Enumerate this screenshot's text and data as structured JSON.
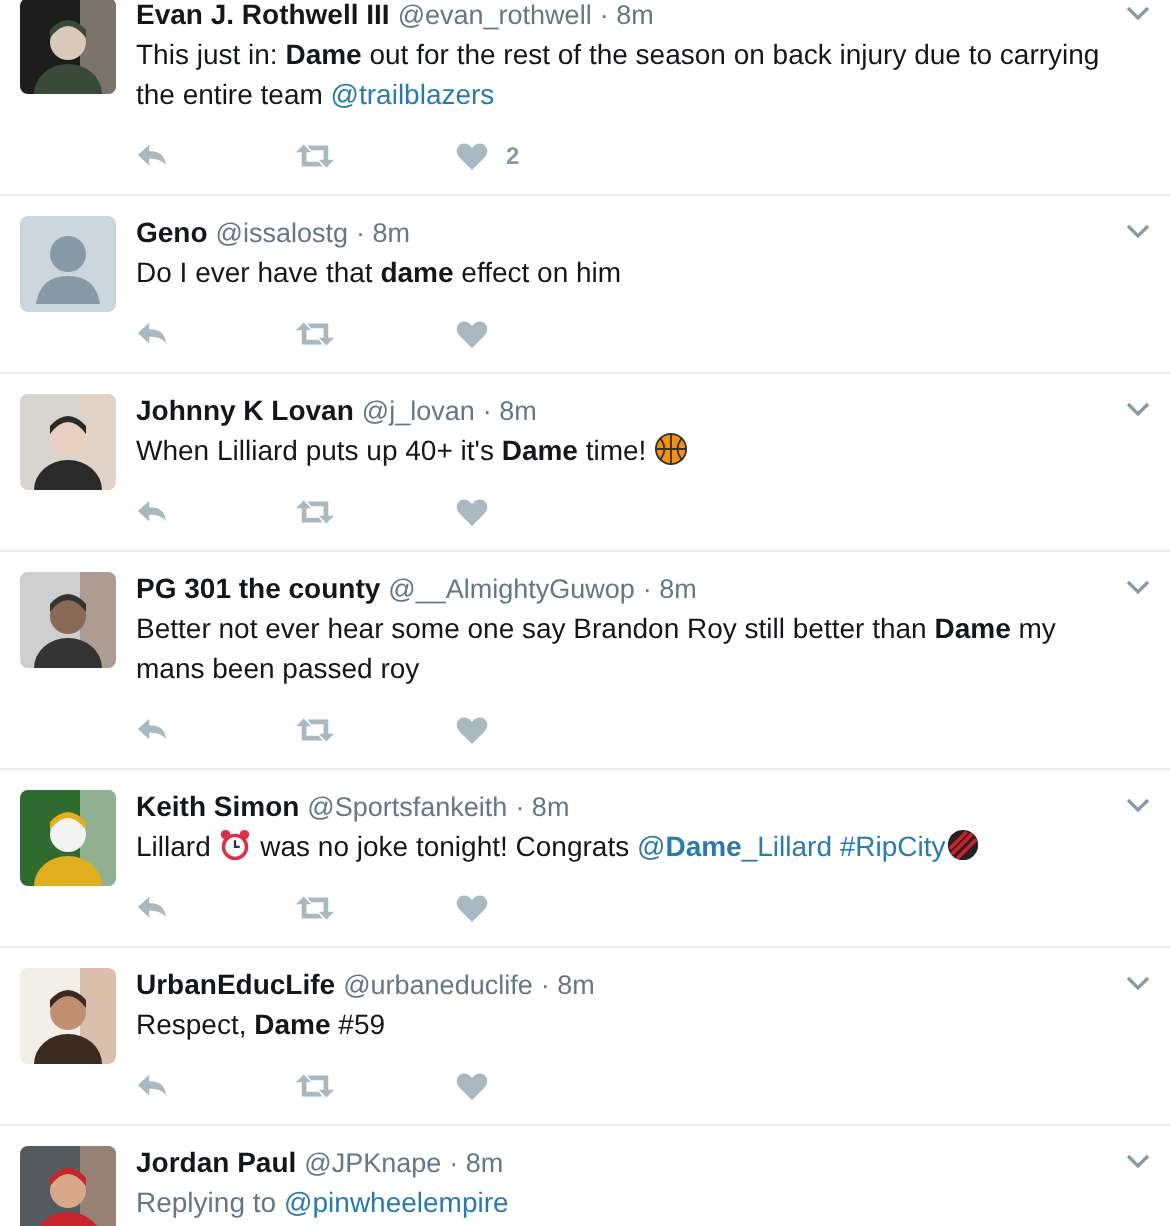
{
  "tweets": [
    {
      "avatar": {
        "kind": "picture"
      },
      "name": "Evan J. Rothwell III",
      "handle": "@evan_rothwell",
      "time": "· 8m",
      "parts": [
        {
          "kind": "text",
          "text": "This just in: **Dame** out for the rest of the season on back injury due to carrying the entire team "
        },
        {
          "kind": "link",
          "text": "@trailblazers"
        }
      ],
      "likes": "2"
    },
    {
      "avatar": {
        "kind": "default"
      },
      "name": "Geno",
      "handle": "@issalostg",
      "time": "· 8m",
      "parts": [
        {
          "kind": "text",
          "text": "Do I ever have that **dame** effect on him"
        }
      ]
    },
    {
      "avatar": {
        "kind": "picture"
      },
      "name": "Johnny K Lovan",
      "handle": "@j_lovan",
      "time": "· 8m",
      "parts": [
        {
          "kind": "text",
          "text": "When Lilliard puts up 40+ it's **Dame** time! "
        },
        {
          "kind": "basketball"
        }
      ]
    },
    {
      "avatar": {
        "kind": "picture"
      },
      "name": "PG 301 the county",
      "handle": "@__AlmightyGuwop",
      "time": "· 8m",
      "parts": [
        {
          "kind": "text",
          "text": "Better not ever hear some one say Brandon Roy still better than **Dame** my mans been passed roy"
        }
      ]
    },
    {
      "avatar": {
        "kind": "picture"
      },
      "name": "Keith Simon",
      "handle": "@Sportsfankeith",
      "time": "· 8m",
      "parts": [
        {
          "kind": "text",
          "text": "Lillard "
        },
        {
          "kind": "alarm"
        },
        {
          "kind": "text",
          "text": " was no joke tonight! Congrats "
        },
        {
          "kind": "link",
          "text": "@**Dame**_Lillard"
        },
        {
          "kind": "link",
          "text": "#RipCity"
        },
        {
          "kind": "pinwheel"
        }
      ]
    },
    {
      "avatar": {
        "kind": "picture"
      },
      "name": "UrbanEducLife",
      "handle": "@urbaneduclife",
      "time": "· 8m",
      "parts": [
        {
          "kind": "text",
          "text": "Respect, **Dame** #59"
        }
      ]
    },
    {
      "avatar": {
        "kind": "picture"
      },
      "name": "Jordan Paul",
      "handle": "@JPKnape",
      "time": "· 8m",
      "reply_to": {
        "label": "Replying to",
        "link": "@pinwheelempire"
      }
    }
  ]
}
